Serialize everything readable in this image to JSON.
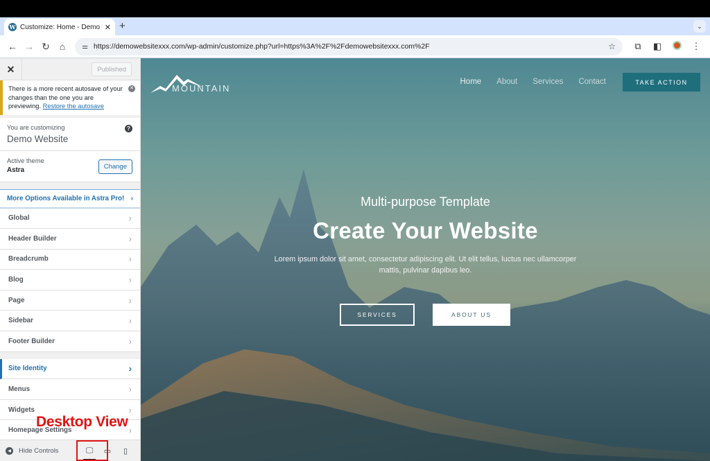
{
  "browser": {
    "tab_title": "Customize: Home - Demo Website",
    "tab_title_display": "Customize: Home - Demo We",
    "url": "https://demowebsitexxx.com/wp-admin/customize.php?url=https%3A%2F%2Fdemowebsitexxx.com%2F",
    "icons": [
      "wordpress-icon",
      "close-icon",
      "plus-icon",
      "chevron-down-icon",
      "back-icon",
      "forward-icon",
      "reload-icon",
      "home-icon",
      "site-settings-icon",
      "star-icon",
      "extensions-icon",
      "side-panel-icon",
      "profile-avatar",
      "menu-icon"
    ]
  },
  "sidebar": {
    "close_label": "✕",
    "published_label": "Published",
    "notice": {
      "text": "There is a more recent autosave of your changes than the one you are previewing.",
      "link": "Restore the autosave"
    },
    "customizing_label": "You are customizing",
    "site_name": "Demo Website",
    "active_theme_label": "Active theme",
    "theme_name": "Astra",
    "change_label": "Change",
    "promo_label": "More Options Available in Astra Pro!",
    "group1": [
      {
        "label": "Global"
      },
      {
        "label": "Header Builder"
      },
      {
        "label": "Breadcrumb"
      },
      {
        "label": "Blog"
      },
      {
        "label": "Page"
      },
      {
        "label": "Sidebar"
      },
      {
        "label": "Footer Builder"
      }
    ],
    "group2": [
      {
        "label": "Site Identity",
        "active": true
      },
      {
        "label": "Menus"
      },
      {
        "label": "Widgets"
      },
      {
        "label": "Homepage Settings"
      }
    ],
    "hide_controls_label": "Hide Controls",
    "devices": [
      "desktop",
      "tablet",
      "mobile"
    ],
    "active_device": "desktop"
  },
  "annotation": {
    "label": "Desktop View",
    "color": "#e01414"
  },
  "preview": {
    "logo_text": "MOUNTAIN",
    "nav": [
      "Home",
      "About",
      "Services",
      "Contact"
    ],
    "cta_label": "TAKE ACTION",
    "hero_subtitle": "Multi-purpose Template",
    "hero_title": "Create Your Website",
    "hero_description": "Lorem ipsum dolor sit amet, consectetur adipiscing elit. Ut elit tellus, luctus nec ullamcorper mattis, pulvinar dapibus leo.",
    "button_services": "SERVICES",
    "button_about": "ABOUT US",
    "accent_color": "#1f6e7c"
  }
}
